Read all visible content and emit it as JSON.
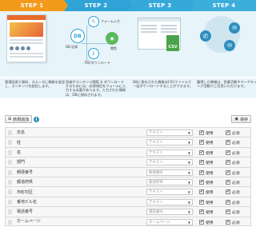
{
  "steps": [
    {
      "label": "STEP 1"
    },
    {
      "label": "STEP 2"
    },
    {
      "label": "STEP 3"
    },
    {
      "label": "STEP 4"
    }
  ],
  "step2": {
    "node_form": "フォーム入力",
    "node_db": "DB 記録",
    "node_view": "閲覧",
    "node_pdf": "PDFダウンロード"
  },
  "step3": {
    "csv_label": "CSV"
  },
  "descriptions": [
    "管理画面で資料、スムーズに情報を設定し、コンテンツを配信します。",
    "読者がコンテンツ閲覧 & ダウンロードするためには、必須項目をフォームに入力する必要があります。入力された情報は、DBに保存されます。",
    "DBに保存された情報はCSVファイルで一括ダウンロードすることができます。",
    "獲得した情報は、営業活動やマーケティング活動でご活用いただけます。"
  ],
  "toolbar": {
    "add_label": "新規追加",
    "info": "i",
    "save_label": "保存"
  },
  "field_options": {
    "use_label": "使用",
    "required_label": "必須"
  },
  "fields": [
    {
      "label": "氏名",
      "type": "テキスト",
      "use": true,
      "required": true
    },
    {
      "label": "姓",
      "type": "テキスト",
      "use": true,
      "required": true
    },
    {
      "label": "名",
      "type": "テキスト",
      "use": true,
      "required": true
    },
    {
      "label": "部門",
      "type": "テキスト",
      "use": true,
      "required": true
    },
    {
      "label": "郵便番号",
      "type": "郵便番号",
      "use": true,
      "required": true
    },
    {
      "label": "都道府県",
      "type": "都道府県",
      "use": true,
      "required": true
    },
    {
      "label": "市町村区",
      "type": "テキスト",
      "use": true,
      "required": true
    },
    {
      "label": "番地ビル名",
      "type": "テキスト",
      "use": true,
      "required": true
    },
    {
      "label": "電話番号",
      "type": "電話番号",
      "use": true,
      "required": true
    },
    {
      "label": "ホームページ",
      "type": "ホームページ",
      "use": true,
      "required": true
    }
  ]
}
